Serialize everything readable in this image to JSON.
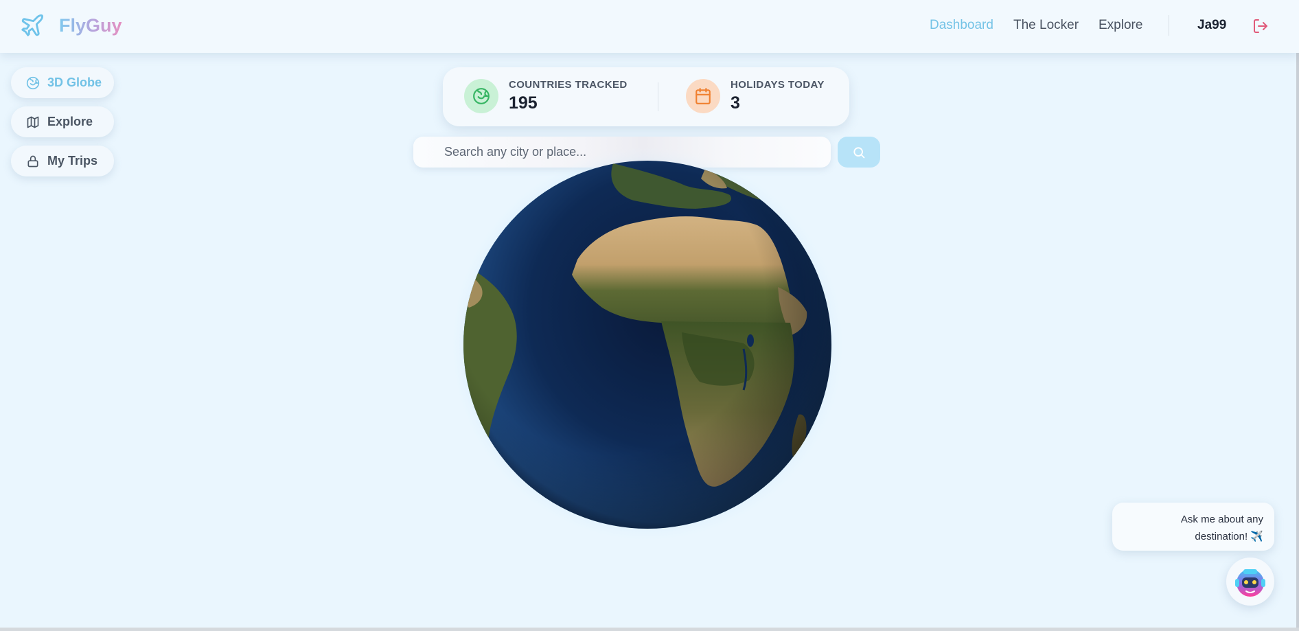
{
  "brand": {
    "name": "FlyGuy",
    "icon": "plane-icon"
  },
  "nav": {
    "items": [
      {
        "label": "Dashboard",
        "active": true
      },
      {
        "label": "The Locker",
        "active": false
      },
      {
        "label": "Explore",
        "active": false
      }
    ],
    "username": "Ja99",
    "logout_icon": "logout-icon"
  },
  "sidebar": {
    "items": [
      {
        "label": "3D Globe",
        "icon": "globe-icon",
        "active": true
      },
      {
        "label": "Explore",
        "icon": "map-icon",
        "active": false
      },
      {
        "label": "My Trips",
        "icon": "lock-icon",
        "active": false
      }
    ]
  },
  "stats": {
    "countries": {
      "label": "COUNTRIES TRACKED",
      "value": "195",
      "icon": "globe-icon"
    },
    "holidays": {
      "label": "HOLIDAYS TODAY",
      "value": "3",
      "icon": "calendar-icon"
    }
  },
  "search": {
    "placeholder": "Search any city or place...",
    "value": ""
  },
  "chat": {
    "line1": "Ask me about any",
    "line2": "destination! ✈️"
  },
  "colors": {
    "accent": "#74c3e6",
    "background": "#eaf6fe",
    "logout": "#e05a7a",
    "holidays_icon": "#f08030",
    "countries_icon": "#36b563"
  }
}
